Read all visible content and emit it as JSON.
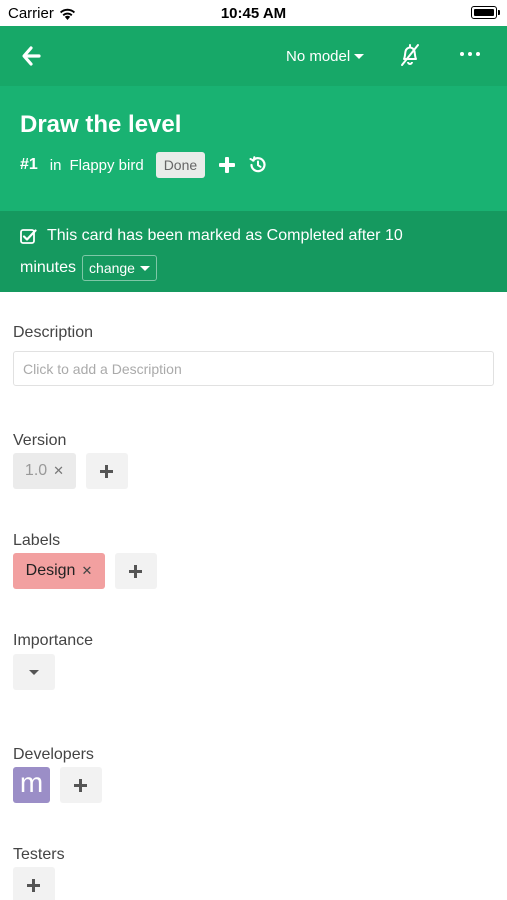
{
  "status_bar": {
    "carrier": "Carrier",
    "time": "10:45 AM"
  },
  "toolbar": {
    "back_icon": "arrow-left-icon",
    "model_label": "No model",
    "bell_icon": "bell-off-icon",
    "more_icon": "ellipsis-icon"
  },
  "card": {
    "title": "Draw the level",
    "number": "#1",
    "in_label": "in",
    "project": "Flappy bird",
    "status": "Done",
    "add_icon": "plus-icon",
    "history_icon": "history-icon"
  },
  "banner": {
    "line1": "This card has been marked as Completed after 10",
    "line2": "minutes",
    "change_label": "change"
  },
  "description": {
    "label": "Description",
    "placeholder": "Click to add a Description"
  },
  "version": {
    "label": "Version",
    "value": "1.0"
  },
  "labels": {
    "label": "Labels",
    "items": [
      {
        "name": "Design"
      }
    ]
  },
  "importance": {
    "label": "Importance"
  },
  "developers": {
    "label": "Developers",
    "avatar_initial": "m"
  },
  "testers": {
    "label": "Testers"
  },
  "colors": {
    "toolbar": "#17a868",
    "header": "#19b272",
    "banner": "#15995f",
    "label_design": "#f2a0a0",
    "avatar": "#9b8ec7"
  }
}
